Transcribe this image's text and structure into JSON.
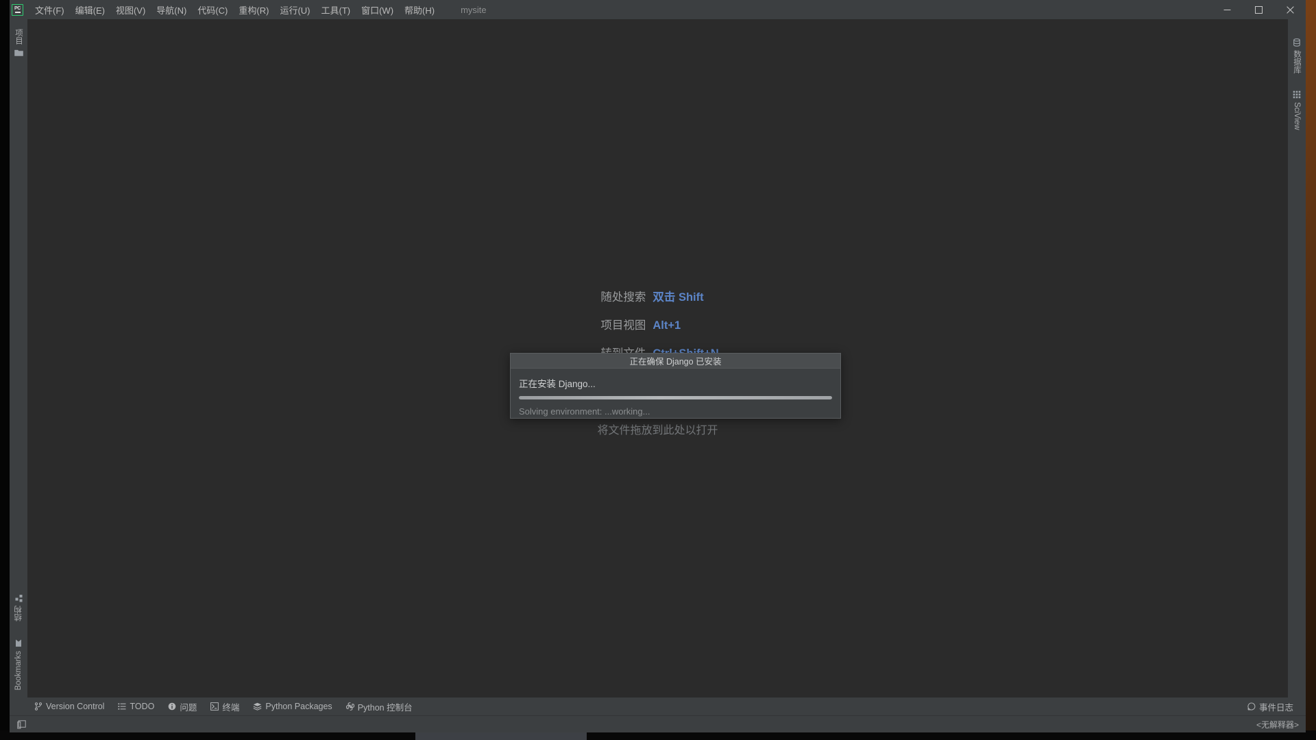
{
  "window": {
    "app_logo_text": "PC",
    "project_name": "mysite",
    "controls": {
      "minimize": "minimize-button",
      "maximize": "maximize-button",
      "close": "close-button"
    }
  },
  "menubar": {
    "items": [
      {
        "label": "文件(F)",
        "mnemonic": "F"
      },
      {
        "label": "编辑(E)",
        "mnemonic": "E"
      },
      {
        "label": "视图(V)",
        "mnemonic": "V"
      },
      {
        "label": "导航(N)",
        "mnemonic": "N"
      },
      {
        "label": "代码(C)",
        "mnemonic": "C"
      },
      {
        "label": "重构(R)",
        "mnemonic": "R"
      },
      {
        "label": "运行(U)",
        "mnemonic": "U"
      },
      {
        "label": "工具(T)",
        "mnemonic": "T"
      },
      {
        "label": "窗口(W)",
        "mnemonic": "W"
      },
      {
        "label": "帮助(H)",
        "mnemonic": "H"
      }
    ]
  },
  "left_stripe": {
    "top_items": [
      {
        "label": "项目",
        "icon": "project-icon"
      }
    ],
    "bottom_items": [
      {
        "label": "结构",
        "icon": "structure-icon"
      },
      {
        "label": "Bookmarks",
        "icon": "bookmarks-icon"
      }
    ]
  },
  "right_stripe": {
    "top_items": [
      {
        "label": "数据库",
        "icon": "database-icon"
      },
      {
        "label": "SciView",
        "icon": "sciview-icon"
      }
    ]
  },
  "editor": {
    "hints": [
      {
        "label": "随处搜索",
        "shortcut": "双击 Shift"
      },
      {
        "label": "项目视图",
        "shortcut": "Alt+1"
      },
      {
        "label": "转到文件",
        "shortcut": "Ctrl+Shift+N"
      }
    ],
    "drop_text": "将文件拖放到此处以打开"
  },
  "dialog": {
    "title": "正在确保 Django 已安装",
    "message": "正在安装 Django...",
    "sub_message": "Solving environment: ...working...",
    "progress_percent": 100,
    "indeterminate": true
  },
  "bottom_toolbar": {
    "items": [
      {
        "label": "Version Control",
        "icon": "branch-icon"
      },
      {
        "label": "TODO",
        "icon": "todo-list-icon"
      },
      {
        "label": "问题",
        "icon": "problems-icon"
      },
      {
        "label": "终端",
        "icon": "terminal-icon"
      },
      {
        "label": "Python Packages",
        "icon": "packages-icon"
      },
      {
        "label": "Python 控制台",
        "icon": "python-console-icon"
      }
    ]
  },
  "statusbar": {
    "layout_icon": "layout-icon",
    "event_log": "事件日志",
    "interpreter": "<无解释器>"
  },
  "colors": {
    "window_chrome": "#3c3f41",
    "editor_bg": "#2b2b2b",
    "accent_blue": "#5c85c8",
    "text_primary": "#bbbbbb",
    "text_muted": "#8a8d8f",
    "logo_green": "#2ecc71",
    "dialog_title_bg": "#4a4d4f"
  }
}
